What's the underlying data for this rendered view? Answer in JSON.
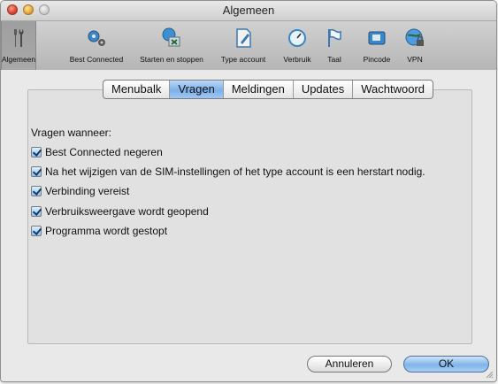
{
  "window": {
    "title": "Algemeen"
  },
  "toolbar": {
    "items": [
      {
        "label": "Algemeen",
        "icon": "tools-icon",
        "active": true
      },
      {
        "label": "Best Connected",
        "icon": "gears-icon"
      },
      {
        "label": "Starten en stoppen",
        "icon": "start-stop-icon"
      },
      {
        "label": "Type account",
        "icon": "document-account-icon"
      },
      {
        "label": "Verbruik",
        "icon": "gauge-icon"
      },
      {
        "label": "Taal",
        "icon": "flag-icon"
      },
      {
        "label": "Pincode",
        "icon": "sim-card-icon"
      },
      {
        "label": "VPN",
        "icon": "globe-lock-icon"
      }
    ]
  },
  "tabs": [
    "Menubalk",
    "Vragen",
    "Meldingen",
    "Updates",
    "Wachtwoord"
  ],
  "selected_tab": "Vragen",
  "intro": "Vragen wanneer:",
  "options": [
    {
      "label": "Best Connected negeren",
      "checked": true
    },
    {
      "label": "Na het wijzigen van de SIM-instellingen of het type account is een herstart nodig.",
      "checked": true
    },
    {
      "label": "Verbinding vereist",
      "checked": true
    },
    {
      "label": "Verbruiksweergave wordt geopend",
      "checked": true
    },
    {
      "label": "Programma wordt gestopt",
      "checked": true
    }
  ],
  "buttons": {
    "cancel": "Annuleren",
    "ok": "OK"
  },
  "colors": {
    "accent": "#7cb0ea",
    "selected_toolbar": "#a3a3a3"
  }
}
